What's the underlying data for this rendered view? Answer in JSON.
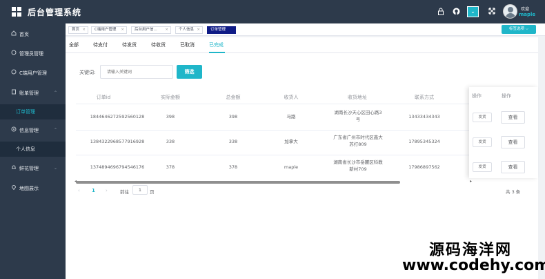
{
  "header": {
    "title": "后台管理系统",
    "welcome": "欢迎",
    "username": "maple",
    "icons": [
      "grid-logo-icon",
      "lock-icon",
      "github-icon",
      "dropdown-icon",
      "fullscreen-icon",
      "avatar"
    ]
  },
  "sidebar": {
    "items": [
      {
        "icon": "home-icon",
        "label": "首页"
      },
      {
        "icon": "admin-icon",
        "label": "管理员管理"
      },
      {
        "icon": "user-icon",
        "label": "C端用户管理"
      },
      {
        "icon": "bill-icon",
        "label": "账单管理"
      },
      {
        "sub": "订单管理"
      },
      {
        "icon": "info-icon",
        "label": "信息管理"
      },
      {
        "sub": "个人信息"
      },
      {
        "icon": "bell-icon",
        "label": "鲜花管理"
      },
      {
        "icon": "map-icon",
        "label": "地图展示"
      }
    ]
  },
  "tags": {
    "items": [
      "首页",
      "C端用户管理",
      "后台用户信...",
      "个人信息",
      "订单管理"
    ],
    "menu_label": "标签选项 ⌵"
  },
  "status_tabs": [
    "全部",
    "待支付",
    "待发货",
    "待收货",
    "已取消",
    "已完成"
  ],
  "filter": {
    "label": "关键词:",
    "placeholder": "请输入关键词",
    "button": "筛选"
  },
  "table": {
    "headers": [
      "订单id",
      "实际金额",
      "总金额",
      "收货人",
      "收货地址",
      "联系方式",
      "操作",
      "操作"
    ],
    "rows": [
      {
        "id": "1844646272592560128",
        "actual": "398",
        "total": "398",
        "receiver": "马路",
        "address": "湖南长沙天心区田心路3号",
        "phone": "13433434343",
        "ship": "发货",
        "view": "查看"
      },
      {
        "id": "1384322968577916928",
        "actual": "338",
        "total": "338",
        "receiver": "加拿大",
        "address": "广东省广州市时代区鑫大苏打809",
        "phone": "17895345324",
        "ship": "发货",
        "view": "查看"
      },
      {
        "id": "1374894696794546176",
        "actual": "378",
        "total": "378",
        "receiver": "maple",
        "address": "湖南省长沙市岳麓区科教新村709",
        "phone": "17986897562",
        "ship": "发货",
        "view": "查看"
      }
    ]
  },
  "pagination": {
    "prev": "‹",
    "current": "1",
    "next": "›",
    "goto_label": "前往",
    "goto_value": "1",
    "page_suffix": "页",
    "total": "共 3 条"
  },
  "watermark": {
    "line1": "源码海洋网",
    "line2": "www.codehy.com"
  },
  "colors": {
    "accent": "#1fb6c9",
    "sidebar": "#2d3a4b",
    "active_tag": "#0f1b86"
  }
}
